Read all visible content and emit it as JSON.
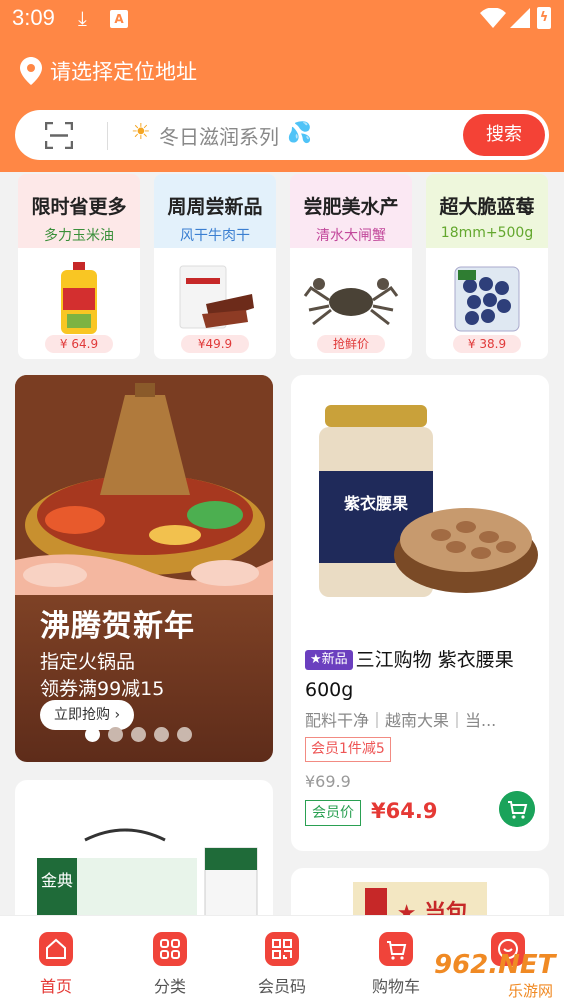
{
  "status_bar": {
    "time": "3:09"
  },
  "location": {
    "label": "请选择定位地址"
  },
  "search": {
    "placeholder": "冬日滋润系列",
    "button": "搜索"
  },
  "categories": [
    {
      "title": "限时省更多",
      "subtitle": "多力玉米油",
      "price": "¥ 64.9",
      "bg": "#fde8e8",
      "sub_color": "#3a8f3a"
    },
    {
      "title": "周周尝新品",
      "subtitle": "风干牛肉干",
      "price": "¥49.9",
      "bg": "#e3f1fb",
      "sub_color": "#3b7fd1"
    },
    {
      "title": "尝肥美水产",
      "subtitle": "清水大闸蟹",
      "price": "抢鲜价",
      "bg": "#fbe8f3",
      "sub_color": "#c2489b"
    },
    {
      "title": "超大脆蓝莓",
      "subtitle": "18mm+500g",
      "price": "¥ 38.9",
      "bg": "#eef7dc",
      "sub_color": "#63a72d"
    }
  ],
  "banner": {
    "title": "沸腾贺新年",
    "line1": "指定火锅品",
    "line2": "领券满99减15",
    "cta": "立即抢购 ›",
    "dots": 5,
    "active_dot": 0
  },
  "product": {
    "tag": "★新品",
    "name": "三江购物 紫衣腰果 600g",
    "package_text": "紫衣腰果",
    "desc": "配料干净｜越南大果｜当...",
    "promo": "会员1件减5",
    "old_price": "¥69.9",
    "member_label": "会员价",
    "member_price": "¥64.9"
  },
  "card3": {
    "brand": "金典"
  },
  "card4": {
    "label": "1 ★ 当包"
  },
  "tabbar": {
    "tabs": [
      {
        "label": "首页",
        "active": true
      },
      {
        "label": "分类",
        "active": false
      },
      {
        "label": "会员码",
        "active": false
      },
      {
        "label": "购物车",
        "active": false
      },
      {
        "label": "我的",
        "active": false
      }
    ]
  },
  "watermark": {
    "big": "962.NET",
    "small": "乐游网"
  },
  "colors": {
    "header": "#ff8745",
    "search_button": "#f44236",
    "member_green": "#2aa052",
    "price_red": "#e53935"
  }
}
